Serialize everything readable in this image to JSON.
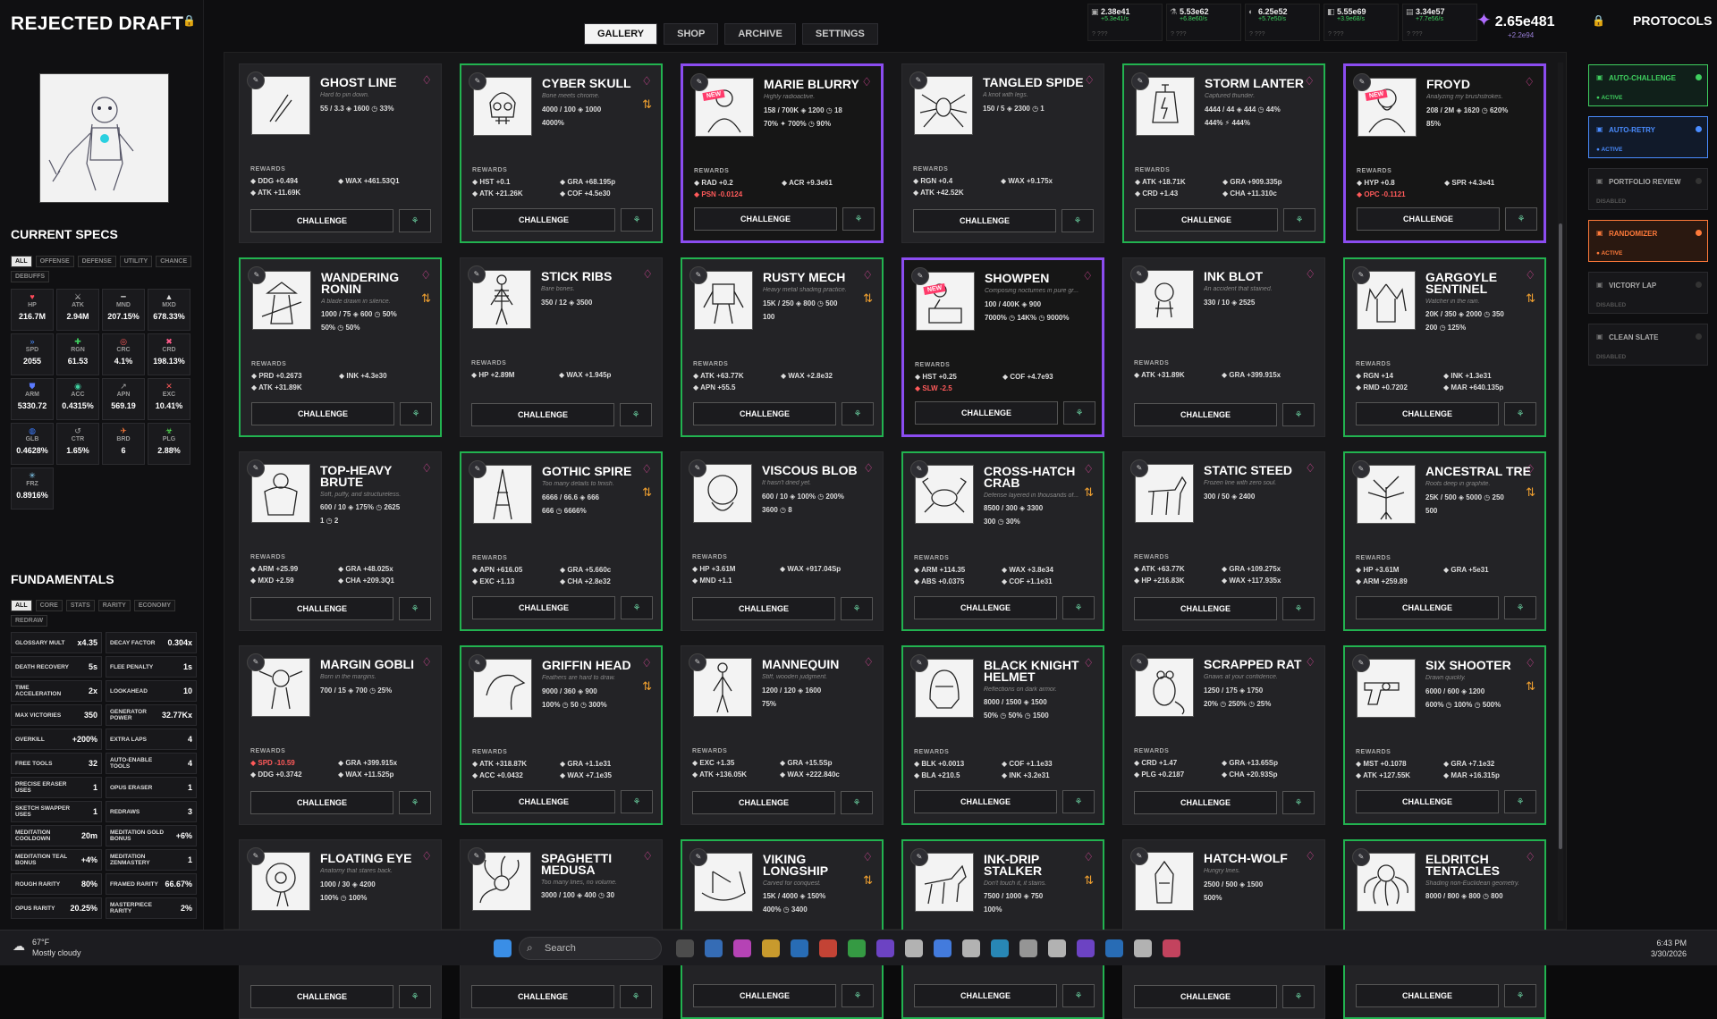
{
  "left": {
    "title": "REJECTED DRAFT",
    "specs_title": "CURRENT SPECS",
    "spec_tabs": [
      "ALL",
      "OFFENSE",
      "DEFENSE",
      "UTILITY",
      "CHANCE",
      "DEBUFFS"
    ],
    "specs": [
      {
        "name": "HP",
        "value": "216.7M",
        "icon": "heart-icon",
        "color": "#ff4a5a"
      },
      {
        "name": "ATK",
        "value": "2.94M",
        "icon": "sword-icon",
        "color": "#cccccc"
      },
      {
        "name": "MND",
        "value": "207.15%",
        "icon": "mind-icon",
        "color": "#bbbbbb"
      },
      {
        "name": "MXD",
        "value": "678.33%",
        "icon": "max-damage-icon",
        "color": "#dddddd"
      },
      {
        "name": "SPD",
        "value": "2055",
        "icon": "speed-icon",
        "color": "#4a8cff"
      },
      {
        "name": "RGN",
        "value": "61.53",
        "icon": "regen-icon",
        "color": "#3fcf5f"
      },
      {
        "name": "CRC",
        "value": "4.1%",
        "icon": "crit-chance-icon",
        "color": "#ff5a5a"
      },
      {
        "name": "CRD",
        "value": "198.13%",
        "icon": "crit-damage-icon",
        "color": "#ff5a8a"
      },
      {
        "name": "ARM",
        "value": "5330.72",
        "icon": "armor-icon",
        "color": "#5a7aff"
      },
      {
        "name": "ACC",
        "value": "0.4315%",
        "icon": "accuracy-icon",
        "color": "#3fcfa0"
      },
      {
        "name": "APN",
        "value": "569.19",
        "icon": "armor-pen-icon",
        "color": "#aaaaaa"
      },
      {
        "name": "EXC",
        "value": "10.41%",
        "icon": "execute-icon",
        "color": "#ff5a5a"
      },
      {
        "name": "GLB",
        "value": "0.4628%",
        "icon": "globe-icon",
        "color": "#3a7aff"
      },
      {
        "name": "CTR",
        "value": "1.65%",
        "icon": "counter-icon",
        "color": "#aaaaaa"
      },
      {
        "name": "BRD",
        "value": "6",
        "icon": "bird-icon",
        "color": "#ff7a3a"
      },
      {
        "name": "PLG",
        "value": "2.88%",
        "icon": "plague-icon",
        "color": "#5aff5a"
      },
      {
        "name": "FRZ",
        "value": "0.8916%",
        "icon": "snowflake-icon",
        "color": "#8ad8ff"
      }
    ],
    "fund_title": "FUNDAMENTALS",
    "fund_tabs": [
      "ALL",
      "CORE",
      "STATS",
      "RARITY",
      "ECONOMY",
      "REDRAW"
    ],
    "fundamentals": [
      {
        "label": "GLOSSARY MULT",
        "value": "x4.35"
      },
      {
        "label": "DECAY FACTOR",
        "value": "0.304x"
      },
      {
        "label": "DEATH RECOVERY",
        "value": "5s"
      },
      {
        "label": "FLEE PENALTY",
        "value": "1s"
      },
      {
        "label": "TIME ACCELERATION",
        "value": "2x"
      },
      {
        "label": "LOOKAHEAD",
        "value": "10"
      },
      {
        "label": "MAX VICTORIES",
        "value": "350"
      },
      {
        "label": "GENERATOR POWER",
        "value": "32.77Kx"
      },
      {
        "label": "OVERKILL",
        "value": "+200%"
      },
      {
        "label": "EXTRA LAPS",
        "value": "4"
      },
      {
        "label": "FREE TOOLS",
        "value": "32"
      },
      {
        "label": "AUTO-ENABLE TOOLS",
        "value": "4"
      },
      {
        "label": "PRECISE ERASER USES",
        "value": "1"
      },
      {
        "label": "OPUS ERASER",
        "value": "1"
      },
      {
        "label": "SKETCH SWAPPER USES",
        "value": "1"
      },
      {
        "label": "REDRAWS",
        "value": "3"
      },
      {
        "label": "MEDITATION COOLDOWN",
        "value": "20m"
      },
      {
        "label": "MEDITATION GOLD BONUS",
        "value": "+6%"
      },
      {
        "label": "MEDITATION TEAL BONUS",
        "value": "+4%"
      },
      {
        "label": "MEDITATION ZENMASTERY",
        "value": "1"
      },
      {
        "label": "ROUGH RARITY",
        "value": "80%"
      },
      {
        "label": "FRAMED RARITY",
        "value": "66.67%"
      },
      {
        "label": "OPUS RARITY",
        "value": "20.25%"
      },
      {
        "label": "MASTERPIECE RARITY",
        "value": "2%"
      }
    ]
  },
  "tabs": [
    "GALLERY",
    "SHOP",
    "ARCHIVE",
    "SETTINGS"
  ],
  "resources": [
    {
      "value": "2.38e41",
      "rate": "+5.3e41/s",
      "locked": "? ???",
      "icon": "coin-icon"
    },
    {
      "value": "5.53e62",
      "rate": "+6.8e60/s",
      "locked": "? ???",
      "icon": "flask-icon"
    },
    {
      "value": "6.25e52",
      "rate": "+5.7e50/s",
      "locked": "? ???",
      "icon": "palette-icon"
    },
    {
      "value": "5.55e69",
      "rate": "+3.9e68/s",
      "locked": "? ???",
      "icon": "ink-icon"
    },
    {
      "value": "3.34e57",
      "rate": "+7.7e56/s",
      "locked": "? ???",
      "icon": "bottle-icon"
    }
  ],
  "total": {
    "value": "2.65e481",
    "rate": "+2.2e94"
  },
  "protocols": {
    "title": "PROTOCOLS",
    "items": [
      {
        "name": "AUTO-CHALLENGE",
        "status": "● ACTIVE",
        "color": "#3fcf5f"
      },
      {
        "name": "AUTO-RETRY",
        "status": "● ACTIVE",
        "color": "#4a8cff"
      },
      {
        "name": "PORTFOLIO REVIEW",
        "status": "DISABLED",
        "color": "#777777"
      },
      {
        "name": "RANDOMIZER",
        "status": "● ACTIVE",
        "color": "#ff7a3a"
      },
      {
        "name": "VICTORY LAP",
        "status": "DISABLED",
        "color": "#777777"
      },
      {
        "name": "CLEAN SLATE",
        "status": "DISABLED",
        "color": "#777777"
      }
    ]
  },
  "challenge_label": "CHALLENGE",
  "rewards_label": "REWARDS",
  "new_label": "NEW",
  "cards": [
    {
      "name": "GHOST LINE",
      "desc": "Hard to pin down.",
      "stats": [
        "55 / 3.3 ◈ 1600 ◷ 33%"
      ],
      "rewards": [
        "DDG +0.494",
        "WAX +461.53Q1",
        "ATK +11.69K",
        ""
      ],
      "border": "none",
      "art": "ghost"
    },
    {
      "name": "CYBER SKULL",
      "desc": "Bone meets chrome.",
      "stats": [
        "4000 / 100 ◈ 1000",
        "4000%"
      ],
      "rewards": [
        "HST +0.1",
        "GRA +68.195p",
        "ATK +21.26K",
        "COF +4.5e30"
      ],
      "border": "green",
      "art": "skull",
      "swap": true
    },
    {
      "name": "MARIE BLURRY",
      "desc": "Highly radioactive.",
      "stats": [
        "158 / 700K ◈ 1200 ◷ 18",
        "70% ✦ 700% ◷ 90%"
      ],
      "rewards": [
        "RAD +0.2",
        "ACR +9.3e61",
        "PSN -0.0124",
        ""
      ],
      "border": "purple",
      "art": "portrait",
      "isnew": true,
      "neg": [
        2
      ]
    },
    {
      "name": "TANGLED SPIDE",
      "desc": "A knot with legs.",
      "stats": [
        "150 / 5 ◈ 2300 ◷ 1"
      ],
      "rewards": [
        "RGN +0.4",
        "WAX +9.175x",
        "ATK +42.52K",
        ""
      ],
      "border": "none",
      "art": "spider"
    },
    {
      "name": "STORM LANTER",
      "desc": "Captured thunder.",
      "stats": [
        "4444 / 44 ◈ 444 ◷ 44%",
        "444% ⚡ 444%"
      ],
      "rewards": [
        "ATK +18.71K",
        "GRA +909.335p",
        "CRD +1.43",
        "CHA +11.310c"
      ],
      "border": "green",
      "art": "lantern"
    },
    {
      "name": "FROYD",
      "desc": "Analyzing my brushstrokes.",
      "stats": [
        "208 / 2M ◈ 1620 ◷ 620%",
        "85%"
      ],
      "rewards": [
        "HYP +0.8",
        "SPR +4.3e41",
        "OPC -0.1121",
        ""
      ],
      "border": "purple",
      "art": "froyd",
      "isnew": true,
      "neg": [
        2
      ]
    },
    {
      "name": "WANDERING RONIN",
      "desc": "A blade drawn in silence.",
      "stats": [
        "1000 / 75 ◈ 600 ◷ 50%",
        "50% ◷ 50%"
      ],
      "rewards": [
        "PRD +0.2673",
        "INK +4.3e30",
        "ATK +31.89K",
        ""
      ],
      "border": "green",
      "art": "ronin",
      "swap": true,
      "two": true
    },
    {
      "name": "STICK RIBS",
      "desc": "Bare bones.",
      "stats": [
        "350 / 12 ◈ 3500"
      ],
      "rewards": [
        "HP +2.89M",
        "WAX +1.945p",
        "",
        ""
      ],
      "border": "none",
      "art": "skeleton"
    },
    {
      "name": "RUSTY MECH",
      "desc": "Heavy metal shading practice.",
      "stats": [
        "15K / 250 ◈ 800 ◷ 500",
        "100"
      ],
      "rewards": [
        "ATK +63.77K",
        "WAX +2.8e32",
        "APN +55.5",
        ""
      ],
      "border": "green",
      "art": "mech",
      "swap": true
    },
    {
      "name": "SHOWPEN",
      "desc": "Composing nocturnes in pure gr...",
      "stats": [
        "100 / 400K ◈ 900",
        "7000% ◷ 14K% ◷ 9000%"
      ],
      "rewards": [
        "HST +0.25",
        "COF +4.7e93",
        "SLW -2.5",
        ""
      ],
      "border": "purple",
      "art": "piano",
      "isnew": true,
      "neg": [
        2
      ]
    },
    {
      "name": "INK BLOT",
      "desc": "An accident that stained.",
      "stats": [
        "330 / 10 ◈ 2525"
      ],
      "rewards": [
        "ATK +31.89K",
        "GRA +399.915x",
        "",
        ""
      ],
      "border": "none",
      "art": "blot"
    },
    {
      "name": "GARGOYLE SENTINEL",
      "desc": "Watcher in the rain.",
      "stats": [
        "20K / 350 ◈ 2000 ◷ 350",
        "200 ◷ 125%"
      ],
      "rewards": [
        "RGN +14",
        "INK +1.3e31",
        "RMD +0.7202",
        "MAR +640.135p"
      ],
      "border": "green",
      "art": "gargoyle",
      "swap": true,
      "two": true
    },
    {
      "name": "TOP-HEAVY BRUTE",
      "desc": "Soft, puffy, and structureless.",
      "stats": [
        "600 / 10 ◈ 175% ◷ 2625",
        "1 ◷ 2"
      ],
      "rewards": [
        "ARM +25.99",
        "GRA +48.025x",
        "MXD +2.59",
        "CHA +209.3Q1"
      ],
      "border": "none",
      "art": "brute",
      "two": true
    },
    {
      "name": "GOTHIC SPIRE",
      "desc": "Too many details to finish.",
      "stats": [
        "6666 / 66.6 ◈ 666",
        "666 ◷ 6666%"
      ],
      "rewards": [
        "APN +616.05",
        "GRA +5.660c",
        "EXC +1.13",
        "CHA +2.8e32"
      ],
      "border": "green",
      "art": "spire",
      "swap": true
    },
    {
      "name": "VISCOUS BLOB",
      "desc": "It hasn't dried yet.",
      "stats": [
        "600 / 10 ◈ 100% ◷ 200%",
        "3600 ◷ 8"
      ],
      "rewards": [
        "HP +3.61M",
        "WAX +917.04Sp",
        "MND +1.1",
        ""
      ],
      "border": "none",
      "art": "blob"
    },
    {
      "name": "CROSS-HATCH CRAB",
      "desc": "Defense layered in thousands of...",
      "stats": [
        "8500 / 300 ◈ 3300",
        "300 ◷ 30%"
      ],
      "rewards": [
        "ARM +114.35",
        "WAX +3.8e34",
        "ABS +0.0375",
        "COF +1.1e31"
      ],
      "border": "green",
      "art": "crab",
      "swap": true,
      "two": true
    },
    {
      "name": "STATIC STEED",
      "desc": "Frozen line with zero soul.",
      "stats": [
        "300 / 50 ◈ 2400"
      ],
      "rewards": [
        "ATK +63.77K",
        "GRA +109.275x",
        "HP +216.83K",
        "WAX +117.935x"
      ],
      "border": "none",
      "art": "horse"
    },
    {
      "name": "ANCESTRAL TRE",
      "desc": "Roots deep in graphite.",
      "stats": [
        "25K / 500 ◈ 5000 ◷ 250",
        "500"
      ],
      "rewards": [
        "HP +3.61M",
        "GRA +5e31",
        "ARM +259.89",
        ""
      ],
      "border": "green",
      "art": "tree",
      "swap": true
    },
    {
      "name": "MARGIN GOBLI",
      "desc": "Born in the margins.",
      "stats": [
        "700 / 15 ◈ 700 ◷ 25%"
      ],
      "rewards": [
        "SPD -10.59",
        "GRA +399.915x",
        "DDG +0.3742",
        "WAX +11.525p"
      ],
      "border": "none",
      "art": "goblin",
      "neg": [
        0
      ]
    },
    {
      "name": "GRIFFIN HEAD",
      "desc": "Feathers are hard to draw.",
      "stats": [
        "9000 / 360 ◈ 900",
        "100% ◷ 50 ◷ 300%"
      ],
      "rewards": [
        "ATK +318.87K",
        "GRA +1.1e31",
        "ACC +0.0432",
        "WAX +7.1e35"
      ],
      "border": "green",
      "art": "eagle",
      "swap": true
    },
    {
      "name": "MANNEQUIN",
      "desc": "Stiff, wooden judgment.",
      "stats": [
        "1200 / 120 ◈ 1600",
        "75%"
      ],
      "rewards": [
        "EXC +1.35",
        "GRA +15.5Sp",
        "ATK +136.05K",
        "WAX +222.840c"
      ],
      "border": "none",
      "art": "mannequin"
    },
    {
      "name": "BLACK KNIGHT HELMET",
      "desc": "Reflections on dark armor.",
      "stats": [
        "8000 / 1500 ◈ 1500",
        "50% ◷ 50% ◷ 1500"
      ],
      "rewards": [
        "BLK +0.0013",
        "COF +1.1e33",
        "BLA +210.5",
        "INK +3.2e31"
      ],
      "border": "green",
      "art": "helmet",
      "two": true
    },
    {
      "name": "SCRAPPED RAT",
      "desc": "Gnaws at your confidence.",
      "stats": [
        "1250 / 175 ◈ 1750",
        "20% ◷ 250% ◷ 25%"
      ],
      "rewards": [
        "CRD +1.47",
        "GRA +13.65Sp",
        "PLG +0.2187",
        "CHA +20.93Sp"
      ],
      "border": "none",
      "art": "rat"
    },
    {
      "name": "SIX SHOOTER",
      "desc": "Drawn quickly.",
      "stats": [
        "6000 / 600 ◈ 1200",
        "600% ◷ 100% ◷ 500%"
      ],
      "rewards": [
        "MST +0.1078",
        "GRA +7.1e32",
        "ATK +127.55K",
        "MAR +16.315p"
      ],
      "border": "green",
      "art": "gun",
      "swap": true
    },
    {
      "name": "FLOATING EYE",
      "desc": "Anatomy that stares back.",
      "stats": [
        "1000 / 30 ◈ 4200",
        "100% ◷ 100%"
      ],
      "rewards": [
        "",
        "",
        "",
        ""
      ],
      "border": "none",
      "art": "eye"
    },
    {
      "name": "SPAGHETTI MEDUSA",
      "desc": "Too many lines, no volume.",
      "stats": [
        "3000 / 100 ◈ 400 ◷ 30"
      ],
      "rewards": [
        "",
        "",
        "",
        ""
      ],
      "border": "none",
      "art": "medusa",
      "two": true
    },
    {
      "name": "VIKING LONGSHIP",
      "desc": "Carved for conquest.",
      "stats": [
        "15K / 4000 ◈ 150%",
        "400% ◷ 3400"
      ],
      "rewards": [
        "",
        "",
        "",
        ""
      ],
      "border": "green",
      "art": "ship",
      "swap": true,
      "two": true
    },
    {
      "name": "INK-DRIP STALKER",
      "desc": "Don't touch it, it stains.",
      "stats": [
        "7500 / 1000 ◈ 750",
        "100%"
      ],
      "rewards": [
        "",
        "",
        "",
        ""
      ],
      "border": "green",
      "art": "wolf",
      "swap": true,
      "two": true
    },
    {
      "name": "HATCH-WOLF",
      "desc": "Hungry lines.",
      "stats": [
        "2500 / 500 ◈ 1500",
        "500%"
      ],
      "rewards": [
        "",
        "",
        "",
        ""
      ],
      "border": "none",
      "art": "wolf2"
    },
    {
      "name": "ELDRITCH TENTACLES",
      "desc": "Shading non-Euclidean geometry.",
      "stats": [
        "8000 / 800 ◈ 800 ◷ 800"
      ],
      "rewards": [
        "",
        "",
        "",
        ""
      ],
      "border": "green",
      "art": "tentacle",
      "two": true
    }
  ],
  "taskbar": {
    "temp": "67°F",
    "weather": "Mostly cloudy",
    "search": "Search",
    "time": "6:43 PM",
    "date": "3/30/2026"
  }
}
